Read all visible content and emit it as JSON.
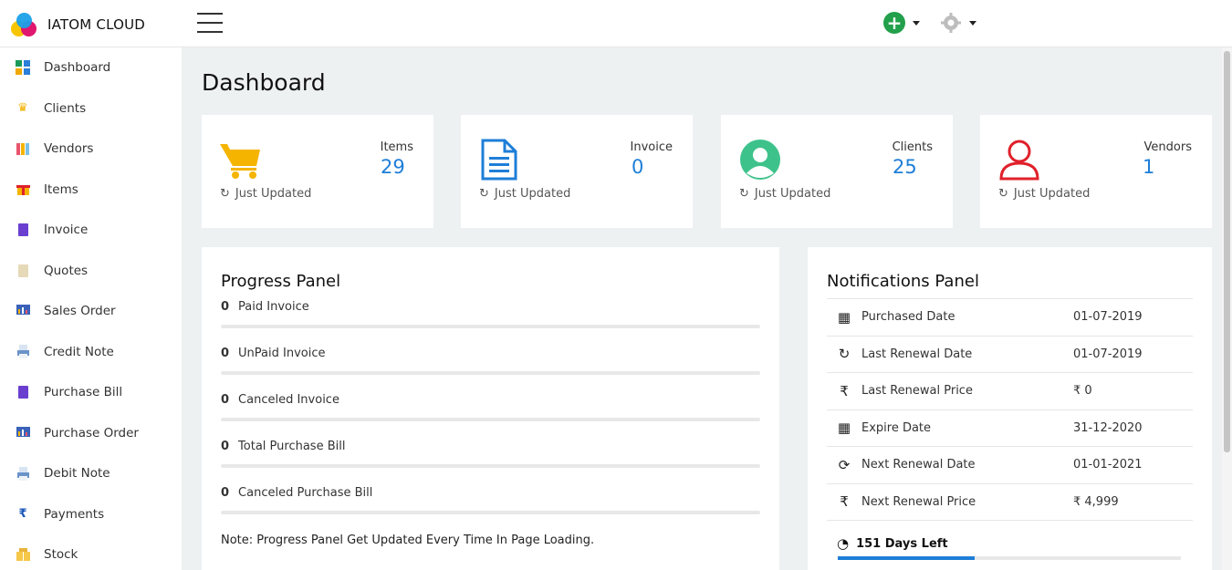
{
  "app": {
    "brand": "IATOM CLOUD"
  },
  "sidebar": {
    "items": [
      {
        "label": "Dashboard",
        "icon": "dashboard-icon"
      },
      {
        "label": "Clients",
        "icon": "crown-icon"
      },
      {
        "label": "Vendors",
        "icon": "vendors-icon"
      },
      {
        "label": "Items",
        "icon": "gift-icon"
      },
      {
        "label": "Invoice",
        "icon": "invoice-icon"
      },
      {
        "label": "Quotes",
        "icon": "quotes-icon"
      },
      {
        "label": "Sales Order",
        "icon": "chart-board-icon"
      },
      {
        "label": "Credit Note",
        "icon": "printer-icon"
      },
      {
        "label": "Purchase Bill",
        "icon": "purchase-bill-icon"
      },
      {
        "label": "Purchase Order",
        "icon": "chart-board-icon"
      },
      {
        "label": "Debit Note",
        "icon": "printer-icon"
      },
      {
        "label": "Payments",
        "icon": "rupee-icon"
      },
      {
        "label": "Stock",
        "icon": "stock-icon"
      }
    ]
  },
  "main": {
    "title": "Dashboard",
    "stats": [
      {
        "name": "Items",
        "value": "29",
        "foot": "Just Updated",
        "icon": "cart-icon",
        "color": "#f5b400"
      },
      {
        "name": "Invoice",
        "value": "0",
        "foot": "Just Updated",
        "icon": "document-icon",
        "color": "#1e7ed8"
      },
      {
        "name": "Clients",
        "value": "25",
        "foot": "Just Updated",
        "icon": "user-circle-icon",
        "color": "#3ec28b"
      },
      {
        "name": "Vendors",
        "value": "1",
        "foot": "Just Updated",
        "icon": "user-outline-icon",
        "color": "#e0212b"
      }
    ],
    "progress": {
      "title": "Progress Panel",
      "rows": [
        {
          "count": "0",
          "label": "Paid Invoice",
          "fraction": 0
        },
        {
          "count": "0",
          "label": "UnPaid Invoice",
          "fraction": 0
        },
        {
          "count": "0",
          "label": "Canceled Invoice",
          "fraction": 0
        },
        {
          "count": "0",
          "label": "Total Purchase Bill",
          "fraction": 0
        },
        {
          "count": "0",
          "label": "Canceled Purchase Bill",
          "fraction": 0
        }
      ],
      "note": "Note: Progress Panel Get Updated Every Time In Page Loading."
    },
    "notifications": {
      "title": "Notifications Panel",
      "rows": [
        {
          "icon": "calendar-icon",
          "label": "Purchased Date",
          "value": "01-07-2019"
        },
        {
          "icon": "refresh-icon",
          "label": "Last Renewal Date",
          "value": "01-07-2019"
        },
        {
          "icon": "rupee-icon",
          "label": "Last Renewal Price",
          "value": "₹ 0"
        },
        {
          "icon": "calendar-icon",
          "label": "Expire Date",
          "value": "31-12-2020"
        },
        {
          "icon": "sync-icon",
          "label": "Next Renewal Date",
          "value": "01-01-2021"
        },
        {
          "icon": "rupee-icon",
          "label": "Next Renewal Price",
          "value": "₹ 4,999"
        }
      ],
      "days_left": "151 Days Left",
      "days_fraction": 0.4
    }
  }
}
